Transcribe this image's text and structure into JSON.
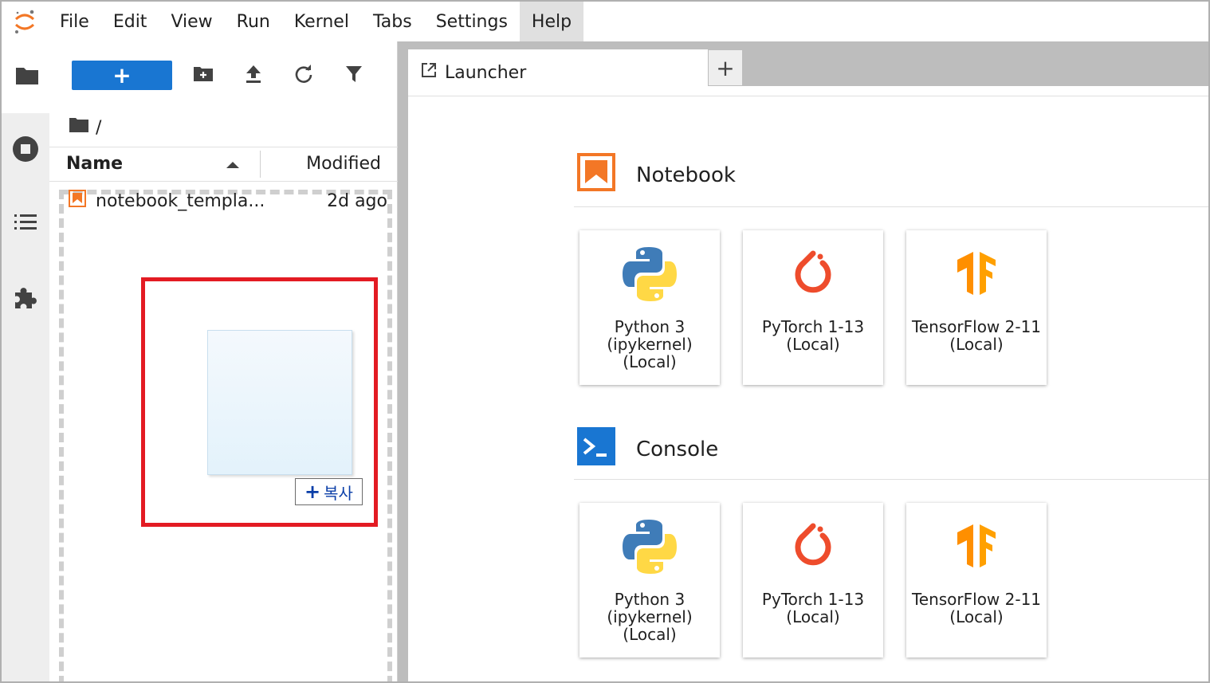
{
  "menubar": {
    "items": [
      "File",
      "Edit",
      "View",
      "Run",
      "Kernel",
      "Tabs",
      "Settings",
      "Help"
    ],
    "active": "Help"
  },
  "activity_bar": {
    "icons": [
      "folder-icon",
      "stop-circle-icon",
      "toc-list-icon",
      "extension-puzzle-icon"
    ]
  },
  "file_browser": {
    "new_button_label": "+",
    "breadcrumb_path": "/",
    "columns": {
      "name": "Name",
      "modified": "Modified"
    },
    "files": [
      {
        "name": "notebook_templa...",
        "modified": "2d ago",
        "icon": "notebook-icon"
      }
    ],
    "drag_tooltip": "복사",
    "drag_tooltip_prefix": "+"
  },
  "tabs": {
    "items": [
      {
        "label": "Launcher",
        "icon": "launcher-icon"
      }
    ],
    "add_label": "+"
  },
  "launcher": {
    "sections": [
      {
        "title": "Notebook",
        "cards": [
          {
            "label": "Python 3 (ipykernel) (Local)",
            "lines": [
              "Python 3",
              "(ipykernel)",
              "(Local)"
            ],
            "icon": "python-icon"
          },
          {
            "label": "PyTorch 1-13 (Local)",
            "lines": [
              "PyTorch 1-13",
              "(Local)"
            ],
            "icon": "pytorch-icon"
          },
          {
            "label": "TensorFlow 2-11 (Local)",
            "lines": [
              "TensorFlow 2-11",
              "(Local)"
            ],
            "icon": "tensorflow-icon"
          }
        ]
      },
      {
        "title": "Console",
        "cards": [
          {
            "label": "Python 3 (ipykernel) (Local)",
            "lines": [
              "Python 3",
              "(ipykernel)",
              "(Local)"
            ],
            "icon": "python-icon"
          },
          {
            "label": "PyTorch 1-13 (Local)",
            "lines": [
              "PyTorch 1-13",
              "(Local)"
            ],
            "icon": "pytorch-icon"
          },
          {
            "label": "TensorFlow 2-11 (Local)",
            "lines": [
              "TensorFlow 2-11",
              "(Local)"
            ],
            "icon": "tensorflow-icon"
          }
        ]
      }
    ]
  },
  "colors": {
    "accent_blue": "#1976d2",
    "notebook_orange": "#f37726",
    "highlight_red": "#e31b23",
    "console_blue": "#1976d2"
  }
}
